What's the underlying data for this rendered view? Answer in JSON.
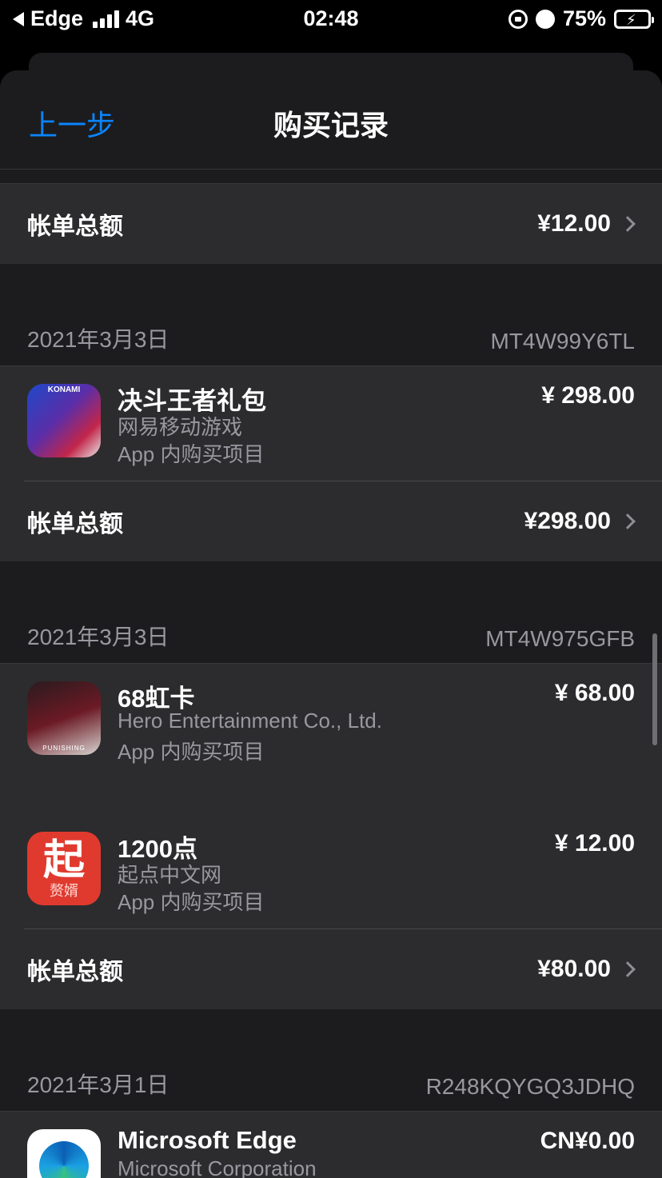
{
  "status_bar": {
    "back_app": "Edge",
    "network": "4G",
    "time": "02:48",
    "battery": "75%"
  },
  "nav": {
    "back_label": "上一步",
    "title": "购买记录"
  },
  "total_label": "帐单总额",
  "first_total": "¥12.00",
  "sections": [
    {
      "date": "2021年3月3日",
      "order_id": "MT4W99Y6TL",
      "items": [
        {
          "name": "决斗王者礼包",
          "developer": "网易移动游戏",
          "type": "App 内购买项目",
          "price": "¥ 298.00",
          "icon": "yugioh-icon",
          "icon_text": "KONAMI"
        }
      ],
      "total": "¥298.00"
    },
    {
      "date": "2021年3月3日",
      "order_id": "MT4W975GFB",
      "items": [
        {
          "name": "68虹卡",
          "developer": "Hero Entertainment Co., Ltd.",
          "type": "App 内购买项目",
          "price": "¥ 68.00",
          "icon": "punishing-icon",
          "icon_text": "PUNISHING"
        },
        {
          "name": "1200点",
          "developer": "起点中文网",
          "type": "App 内购买项目",
          "price": "¥ 12.00",
          "icon": "qidian-icon",
          "icon_text": "起",
          "icon_subtext": "赘婿"
        }
      ],
      "total": "¥80.00"
    },
    {
      "date": "2021年3月1日",
      "order_id": "R248KQYGQ3JDHQ",
      "items": [
        {
          "name": "Microsoft Edge",
          "developer": "Microsoft Corporation",
          "price": "CN¥0.00",
          "icon": "edge-icon"
        }
      ]
    }
  ],
  "colors": {
    "accent": "#0a84ff",
    "background": "#1c1c1e",
    "cell": "#2c2c2e",
    "secondary_text": "#98989f"
  }
}
